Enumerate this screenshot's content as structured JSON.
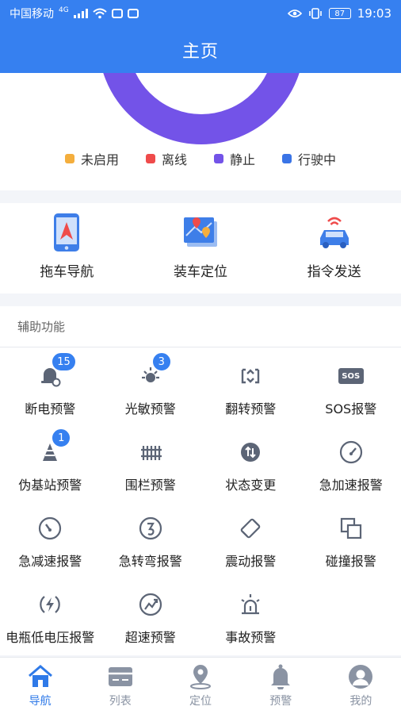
{
  "status_bar": {
    "carrier": "中国移动",
    "network": "4G",
    "battery": "87",
    "time": "19:03"
  },
  "header": {
    "title": "主页"
  },
  "colors": {
    "brand": "#3680f0",
    "legend_unused": "#f4ae3d",
    "legend_offline": "#ef4b4b",
    "legend_static": "#7353e8",
    "legend_moving": "#3a74e6"
  },
  "chart_legend": [
    {
      "label": "未启用",
      "color": "#f4ae3d"
    },
    {
      "label": "离线",
      "color": "#ef4b4b"
    },
    {
      "label": "静止",
      "color": "#7353e8"
    },
    {
      "label": "行驶中",
      "color": "#3a74e6"
    }
  ],
  "quick_actions": [
    {
      "label": "拖车导航",
      "icon": "phone-map-icon"
    },
    {
      "label": "装车定位",
      "icon": "map-pin-icon"
    },
    {
      "label": "指令发送",
      "icon": "car-signal-icon"
    }
  ],
  "aux": {
    "title": "辅助功能",
    "items": [
      {
        "label": "断电预警",
        "icon": "power-off-icon",
        "badge": "15"
      },
      {
        "label": "光敏预警",
        "icon": "light-sensor-icon",
        "badge": "3"
      },
      {
        "label": "翻转预警",
        "icon": "flip-icon",
        "badge": ""
      },
      {
        "label": "SOS报警",
        "icon": "sos-icon",
        "badge": ""
      },
      {
        "label": "伪基站预警",
        "icon": "fake-station-icon",
        "badge": "1"
      },
      {
        "label": "围栏预警",
        "icon": "fence-icon",
        "badge": ""
      },
      {
        "label": "状态变更",
        "icon": "status-change-icon",
        "badge": ""
      },
      {
        "label": "急加速报警",
        "icon": "speedometer-up-icon",
        "badge": ""
      },
      {
        "label": "急减速报警",
        "icon": "speedometer-down-icon",
        "badge": ""
      },
      {
        "label": "急转弯报警",
        "icon": "sharp-turn-icon",
        "badge": ""
      },
      {
        "label": "震动报警",
        "icon": "vibration-icon",
        "badge": ""
      },
      {
        "label": "碰撞报警",
        "icon": "collision-icon",
        "badge": ""
      },
      {
        "label": "电瓶低电压报警",
        "icon": "battery-low-icon",
        "badge": ""
      },
      {
        "label": "超速预警",
        "icon": "overspeed-icon",
        "badge": ""
      },
      {
        "label": "事故预警",
        "icon": "accident-siren-icon",
        "badge": ""
      }
    ]
  },
  "sos_text": "SOS",
  "bottom_nav": [
    {
      "label": "导航",
      "icon": "home-icon",
      "active": true
    },
    {
      "label": "列表",
      "icon": "list-card-icon",
      "active": false
    },
    {
      "label": "定位",
      "icon": "location-icon",
      "active": false
    },
    {
      "label": "预警",
      "icon": "bell-icon",
      "active": false
    },
    {
      "label": "我的",
      "icon": "user-icon",
      "active": false
    }
  ]
}
